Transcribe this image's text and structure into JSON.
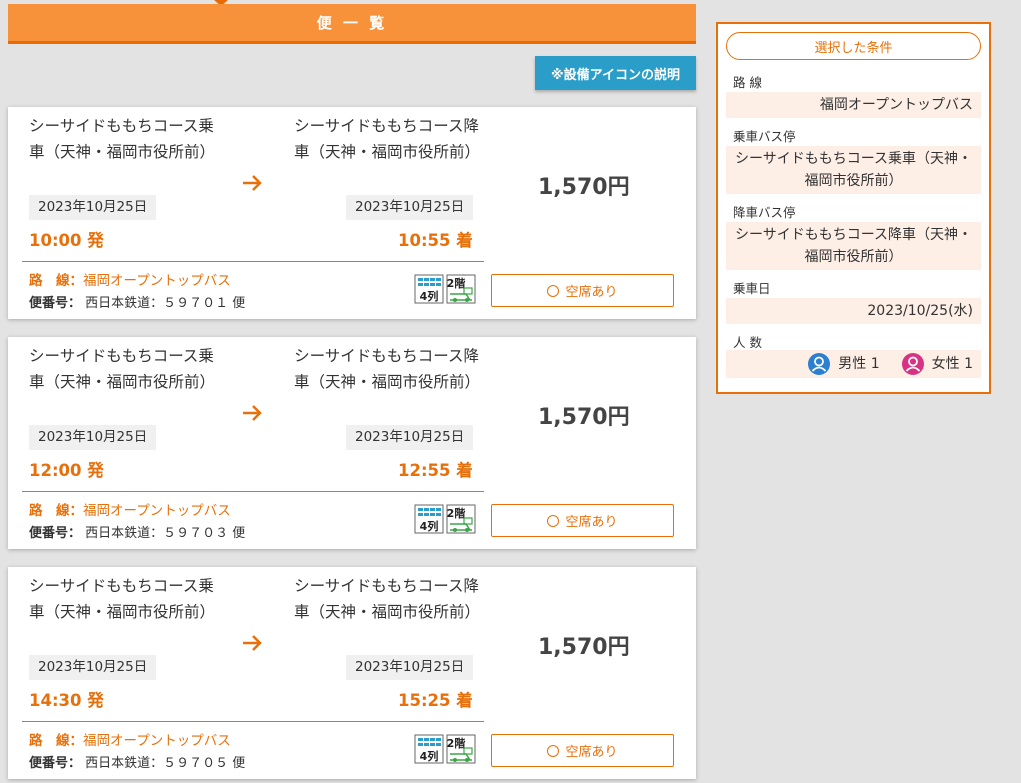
{
  "header": {
    "title": "便 一 覧"
  },
  "legend_button": "※設備アイコンの説明",
  "route_label": "路　線：",
  "flight_label": "便番号：",
  "facility_icons": [
    "seat-rows-icon",
    "double-decker-icon"
  ],
  "colors": {
    "accent": "#e8700a",
    "header": "#f7923a",
    "button_blue": "#2a9dc8",
    "sidebar_bg": "#fdeee6"
  },
  "trips": [
    {
      "dep_stop": "シーサイドももちコース乗車（天神・福岡市役所前）",
      "arr_stop": "シーサイドももちコース降車（天神・福岡市役所前）",
      "dep_date": "2023年10月25日",
      "arr_date": "2023年10月25日",
      "dep_time": "10:00 発",
      "arr_time": "10:55 着",
      "route": "福岡オープントップバス",
      "flight": "西日本鉄道：５９７０１ 便",
      "price": "1,570円",
      "status": "空席あり"
    },
    {
      "dep_stop": "シーサイドももちコース乗車（天神・福岡市役所前）",
      "arr_stop": "シーサイドももちコース降車（天神・福岡市役所前）",
      "dep_date": "2023年10月25日",
      "arr_date": "2023年10月25日",
      "dep_time": "12:00 発",
      "arr_time": "12:55 着",
      "route": "福岡オープントップバス",
      "flight": "西日本鉄道：５９７０３ 便",
      "price": "1,570円",
      "status": "空席あり"
    },
    {
      "dep_stop": "シーサイドももちコース乗車（天神・福岡市役所前）",
      "arr_stop": "シーサイドももちコース降車（天神・福岡市役所前）",
      "dep_date": "2023年10月25日",
      "arr_date": "2023年10月25日",
      "dep_time": "14:30 発",
      "arr_time": "15:25 着",
      "route": "福岡オープントップバス",
      "flight": "西日本鉄道：５９７０５ 便",
      "price": "1,570円",
      "status": "空席あり"
    }
  ],
  "sidebar": {
    "title": "選択した条件",
    "route_label": "路 線",
    "route_value": "福岡オープントップバス",
    "board_label": "乗車バス停",
    "board_value": "シーサイドももちコース乗車（天神・福岡市役所前）",
    "alight_label": "降車バス停",
    "alight_value": "シーサイドももちコース降車（天神・福岡市役所前）",
    "date_label": "乗車日",
    "date_value": "2023/10/25(水)",
    "pax_label": "人 数",
    "male": "男性 1",
    "female": "女性 1"
  }
}
